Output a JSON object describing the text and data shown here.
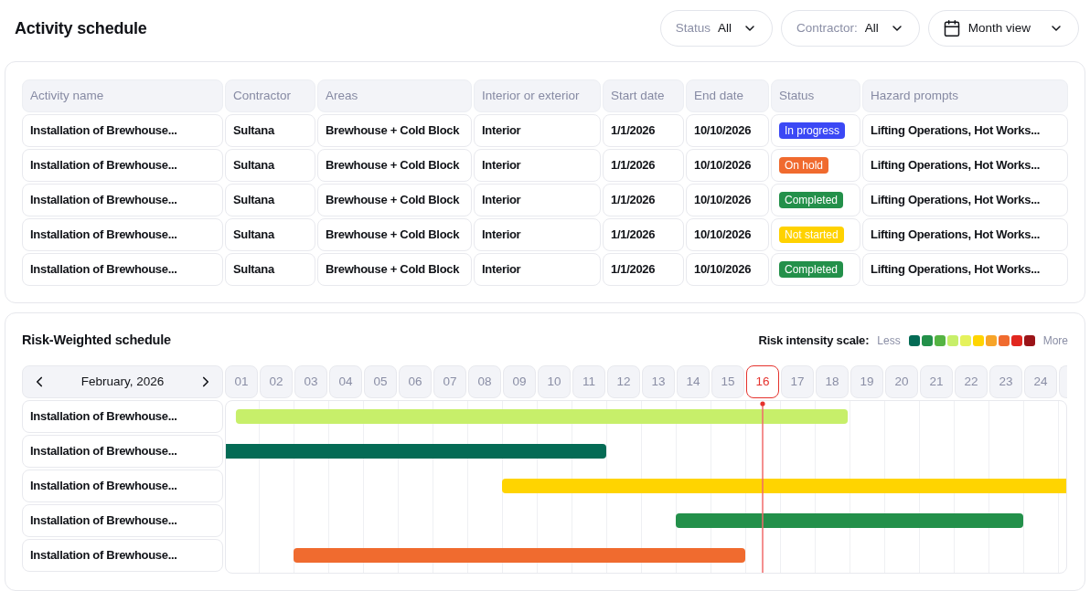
{
  "header": {
    "title": "Activity schedule",
    "filters": [
      {
        "kind": "select",
        "label": "Status",
        "value": "All"
      },
      {
        "kind": "select",
        "label": "Contractor:",
        "value": "All"
      },
      {
        "kind": "view",
        "value": "Month view"
      }
    ]
  },
  "activity_table": {
    "columns": [
      "Activity name",
      "Contractor",
      "Areas",
      "Interior or exterior",
      "Start date",
      "End date",
      "Status",
      "Hazard prompts"
    ],
    "rows": [
      {
        "activity_name": "Installation of Brewhouse...",
        "contractor": "Sultana",
        "areas": "Brewhouse + Cold Block",
        "location": "Interior",
        "start_date": "1/1/2026",
        "end_date": "10/10/2026",
        "status": {
          "text": "In progress",
          "color": "#3b48f5"
        },
        "hazard_prompts": "Lifting Operations, Hot Works..."
      },
      {
        "activity_name": "Installation of Brewhouse...",
        "contractor": "Sultana",
        "areas": "Brewhouse + Cold Block",
        "location": "Interior",
        "start_date": "1/1/2026",
        "end_date": "10/10/2026",
        "status": {
          "text": "On hold",
          "color": "#f06a2e"
        },
        "hazard_prompts": "Lifting Operations, Hot Works..."
      },
      {
        "activity_name": "Installation of Brewhouse...",
        "contractor": "Sultana",
        "areas": "Brewhouse + Cold Block",
        "location": "Interior",
        "start_date": "1/1/2026",
        "end_date": "10/10/2026",
        "status": {
          "text": "Completed",
          "color": "#23904a"
        },
        "hazard_prompts": "Lifting Operations, Hot Works..."
      },
      {
        "activity_name": "Installation of Brewhouse...",
        "contractor": "Sultana",
        "areas": "Brewhouse + Cold Block",
        "location": "Interior",
        "start_date": "1/1/2026",
        "end_date": "10/10/2026",
        "status": {
          "text": "Not started",
          "color": "#ffd200"
        },
        "hazard_prompts": "Lifting Operations, Hot Works..."
      },
      {
        "activity_name": "Installation of Brewhouse...",
        "contractor": "Sultana",
        "areas": "Brewhouse + Cold Block",
        "location": "Interior",
        "start_date": "1/1/2026",
        "end_date": "10/10/2026",
        "status": {
          "text": "Completed",
          "color": "#23904a"
        },
        "hazard_prompts": "Lifting Operations, Hot Works..."
      }
    ]
  },
  "risk_schedule": {
    "title": "Risk-Weighted schedule",
    "scale": {
      "label": "Risk intensity scale:",
      "less": "Less",
      "more": "More",
      "levels": [
        {
          "color": "#046b55"
        },
        {
          "color": "#23904a"
        },
        {
          "color": "#55b443"
        },
        {
          "color": "#c7ef6a"
        },
        {
          "color": "#e5f25c"
        },
        {
          "color": "#ffd400"
        },
        {
          "color": "#f7a428"
        },
        {
          "color": "#f06b2f"
        },
        {
          "color": "#e1271f"
        },
        {
          "color": "#9b1418"
        }
      ]
    },
    "month": "February, 2026",
    "days": [
      {
        "label": "01",
        "selected": false
      },
      {
        "label": "02",
        "selected": false
      },
      {
        "label": "03",
        "selected": false
      },
      {
        "label": "04",
        "selected": false
      },
      {
        "label": "05",
        "selected": false
      },
      {
        "label": "06",
        "selected": false
      },
      {
        "label": "07",
        "selected": false
      },
      {
        "label": "08",
        "selected": false
      },
      {
        "label": "09",
        "selected": false
      },
      {
        "label": "10",
        "selected": false
      },
      {
        "label": "11",
        "selected": false
      },
      {
        "label": "12",
        "selected": false
      },
      {
        "label": "13",
        "selected": false
      },
      {
        "label": "14",
        "selected": false
      },
      {
        "label": "15",
        "selected": false
      },
      {
        "label": "16",
        "selected": true
      },
      {
        "label": "17",
        "selected": false
      },
      {
        "label": "18",
        "selected": false
      },
      {
        "label": "19",
        "selected": false
      },
      {
        "label": "20",
        "selected": false
      },
      {
        "label": "21",
        "selected": false
      },
      {
        "label": "22",
        "selected": false
      },
      {
        "label": "23",
        "selected": false
      },
      {
        "label": "24",
        "selected": false
      }
    ],
    "activities": [
      {
        "name": "Installation of Brewhouse...",
        "color": "#c7ef6a"
      },
      {
        "name": "Installation of Brewhouse...",
        "color": "#046b55"
      },
      {
        "name": "Installation of Brewhouse...",
        "color": "#ffd400"
      },
      {
        "name": "Installation of Brewhouse...",
        "color": "#23904a"
      },
      {
        "name": "Installation of Brewhouse...",
        "color": "#f06b2f"
      }
    ]
  }
}
